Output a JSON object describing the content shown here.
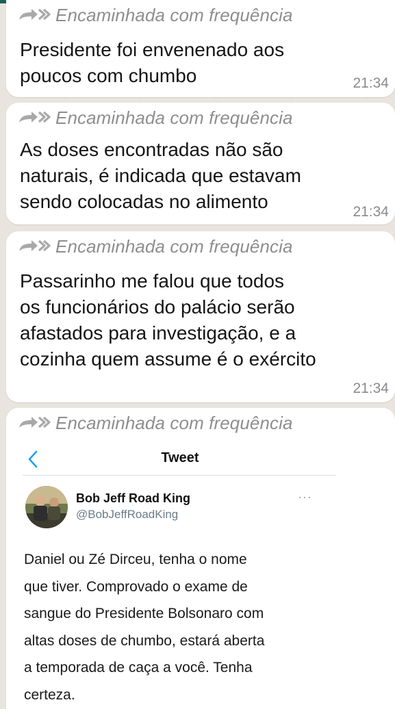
{
  "forward_label": "Encaminhada com frequência",
  "messages": [
    {
      "text": "Presidente foi envenenado aos\npoucos com chumbo",
      "time": "21:34"
    },
    {
      "text": "As doses encontradas não são\nnaturais, é indicada que estavam\nsendo colocadas no alimento",
      "time": "21:34"
    },
    {
      "text": "Passarinho me falou que todos\nos funcionários do palácio serão\nafastados para investigação, e a\ncozinha quem assume é o exército",
      "time": "21:34"
    }
  ],
  "tweet": {
    "title": "Tweet",
    "author_name": "Bob Jeff Road King",
    "author_handle": "@BobJeffRoadKing",
    "more": "···",
    "body": "Daniel ou Zé Dirceu, tenha o nome\nque tiver. Comprovado o exame de\nsangue do Presidente Bolsonaro com\naltas doses de chumbo, estará aberta\na temporada de caça a você. Tenha\ncerteza."
  },
  "icons": {
    "forward": "forwarded-arrows-icon",
    "back": "chevron-left-icon",
    "avatar": "avatar"
  },
  "colors": {
    "chat_background": "#e9e4de",
    "bubble": "#ffffff",
    "forward_text": "#8e8e8e",
    "time_text": "#8a8a8a",
    "tweet_back_arrow": "#1da1f2",
    "header_bar": "#1f5e55"
  }
}
